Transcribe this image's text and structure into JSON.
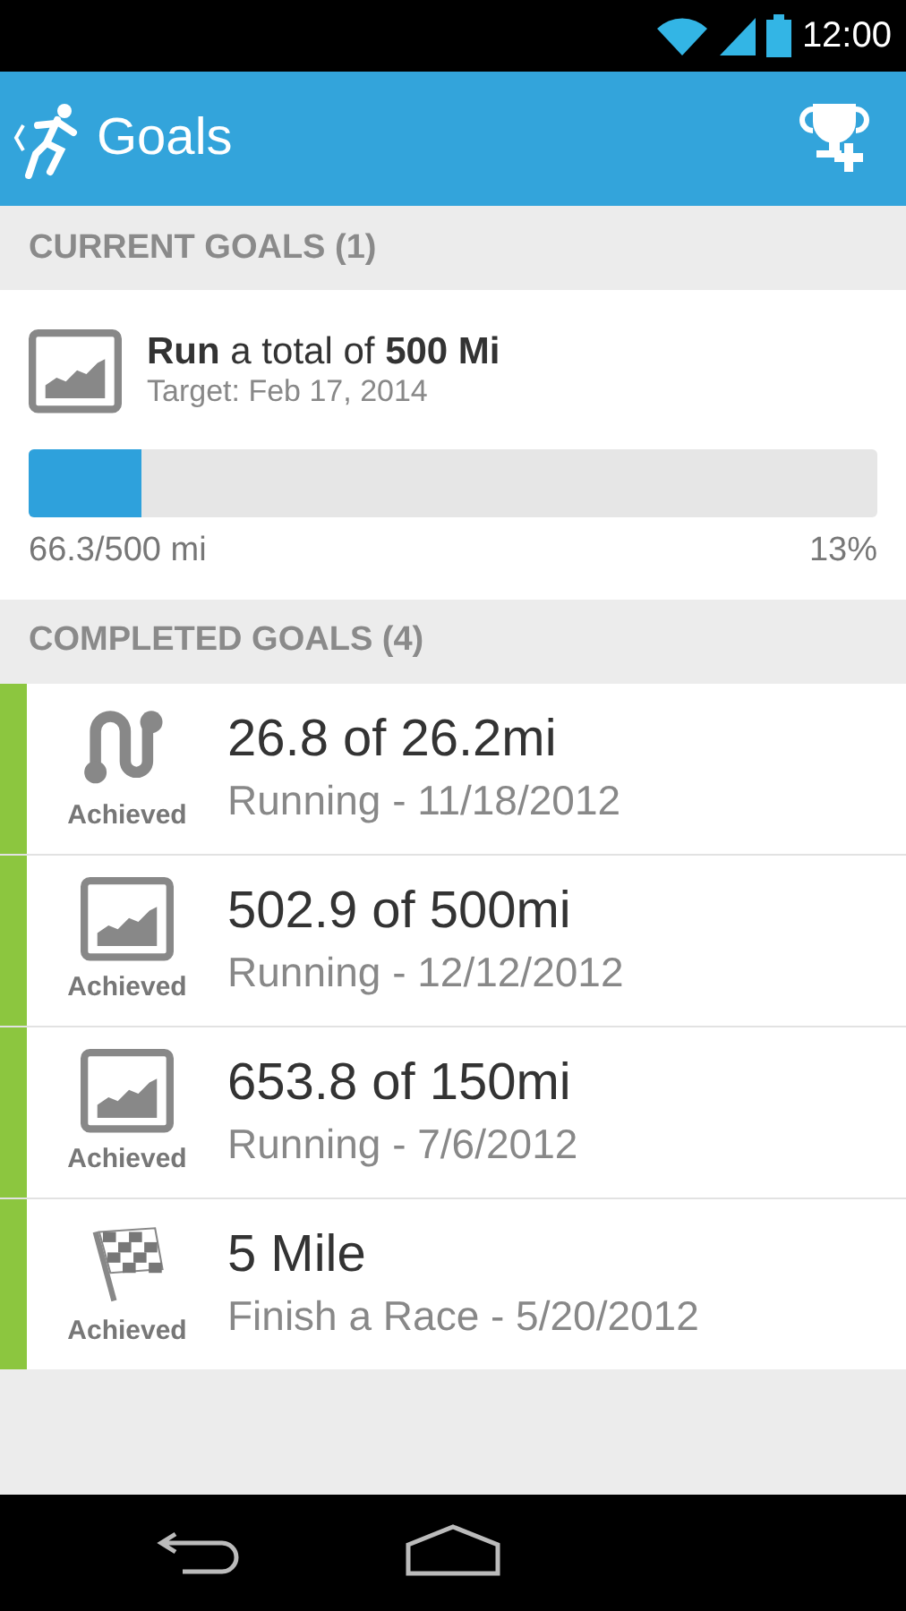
{
  "status_bar": {
    "time": "12:00"
  },
  "app_bar": {
    "title": "Goals"
  },
  "current_section": {
    "title": "CURRENT GOALS (1)"
  },
  "current_goals": [
    {
      "kind": "total",
      "title": "**Run** a total of **500 Mi**",
      "target": "Target: Feb 17, 2014",
      "level": 0.133,
      "progress": "66.3/500 mi",
      "percent": "13%"
    }
  ],
  "completed_section": {
    "title": "COMPLETED GOALS (4)"
  },
  "completed_goals": [
    {
      "kind": "distance",
      "badge": "Achieved",
      "title": "26.8 of 26.2mi",
      "subtitle": "Running - 11/18/2012"
    },
    {
      "kind": "total",
      "badge": "Achieved",
      "title": "502.9 of 500mi",
      "subtitle": "Running - 12/12/2012"
    },
    {
      "kind": "total",
      "badge": "Achieved",
      "title": "653.8 of 150mi",
      "subtitle": "Running - 7/6/2012"
    },
    {
      "kind": "race",
      "badge": "Achieved",
      "title": "5 Mile",
      "subtitle": "Finish a Race - 5/20/2012"
    }
  ]
}
